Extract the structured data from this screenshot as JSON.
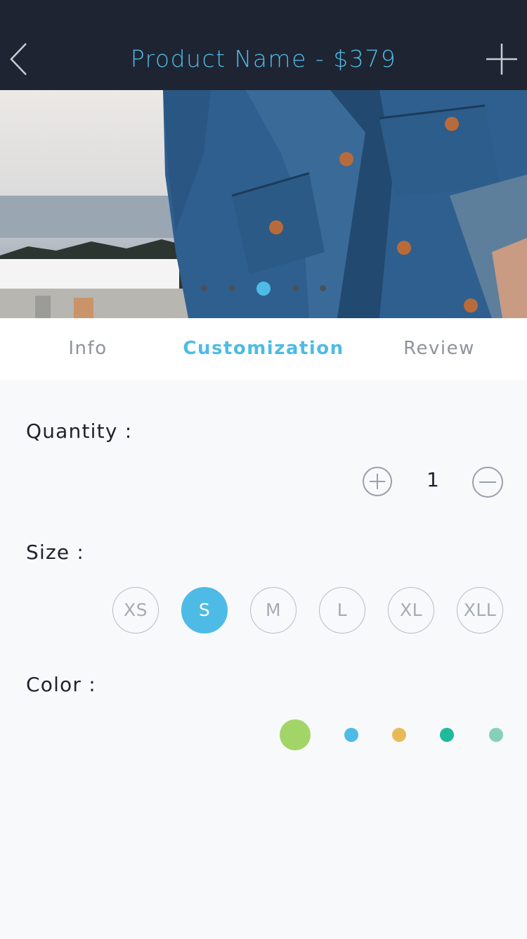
{
  "header": {
    "title": "Product Name - $379",
    "back_icon": "chevron-left-icon",
    "add_icon": "plus-icon"
  },
  "gallery": {
    "image": "denim-shirt-photo",
    "page_count": 5,
    "current_page": 3
  },
  "tabs": [
    {
      "label": "Info",
      "active": false
    },
    {
      "label": "Customization",
      "active": true
    },
    {
      "label": "Review",
      "active": false
    }
  ],
  "quantity": {
    "label": "Quantity :",
    "value": "1",
    "increment_icon": "plus-circle-icon",
    "decrement_icon": "minus-circle-icon"
  },
  "size": {
    "label": "Size :",
    "options": [
      "XS",
      "S",
      "M",
      "L",
      "XL",
      "XLL"
    ],
    "selected": "S"
  },
  "color": {
    "label": "Color :",
    "options": [
      "#a3d468",
      "#4ebbe6",
      "#e8bb58",
      "#1fba9a",
      "#88cfb9"
    ],
    "selected": "#a3d468"
  },
  "theme": {
    "accent": "#4ebbe6",
    "nav_background": "#1f2432"
  }
}
